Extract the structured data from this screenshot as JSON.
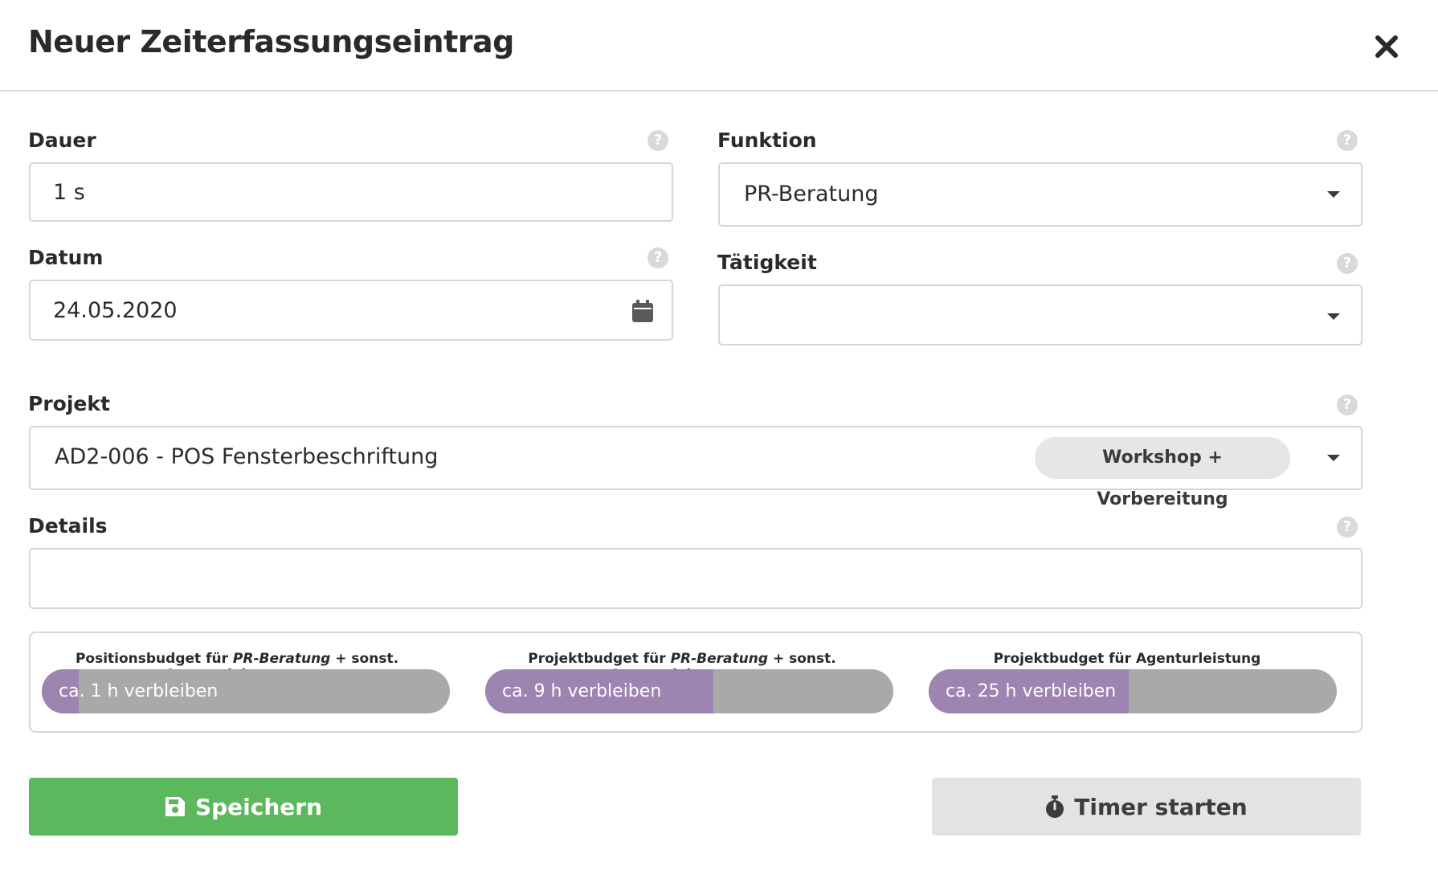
{
  "header": {
    "title": "Neuer Zeiterfassungseintrag"
  },
  "fields": {
    "dauer": {
      "label": "Dauer",
      "value": "1 s"
    },
    "datum": {
      "label": "Datum",
      "value": "24.05.2020"
    },
    "funktion": {
      "label": "Funktion",
      "value": "PR-Beratung"
    },
    "taetigkeit": {
      "label": "Tätigkeit",
      "value": ""
    },
    "projekt": {
      "label": "Projekt",
      "value": "AD2-006 - POS Fensterbeschriftung",
      "tag": "Workshop + Vorbereitung"
    },
    "details": {
      "label": "Details",
      "value": ""
    }
  },
  "help_glyph": "?",
  "budgets": [
    {
      "title_prefix": "Positionsbudget für ",
      "title_emph": "PR-Beratung",
      "title_suffix": " + sonst. Agenturleistungen",
      "text": "ca. 1 h verbleiben",
      "fill_fraction": 0.09
    },
    {
      "title_prefix": "Projektbudget für ",
      "title_emph": "PR-Beratung",
      "title_suffix": " + sonst. Agenturleistungen",
      "text": "ca. 9 h verbleiben",
      "fill_fraction": 0.56
    },
    {
      "title_prefix": "Projektbudget für Agenturleistung",
      "title_emph": "",
      "title_suffix": "",
      "text": "ca. 25 h verbleiben",
      "fill_fraction": 0.49
    }
  ],
  "buttons": {
    "save": "Speichern",
    "timer": "Timer starten"
  },
  "icons": {
    "close": "close-icon",
    "help": "question-circle-icon",
    "calendar": "calendar-icon",
    "dropdown": "caret-down-icon",
    "save": "floppy-disk-icon",
    "timer": "stopwatch-icon"
  },
  "colors": {
    "save_button": "#5cb85c",
    "budget_fill": "#9e84b0",
    "budget_track": "#a9a9a9",
    "timer_button": "#e2e3e5"
  }
}
